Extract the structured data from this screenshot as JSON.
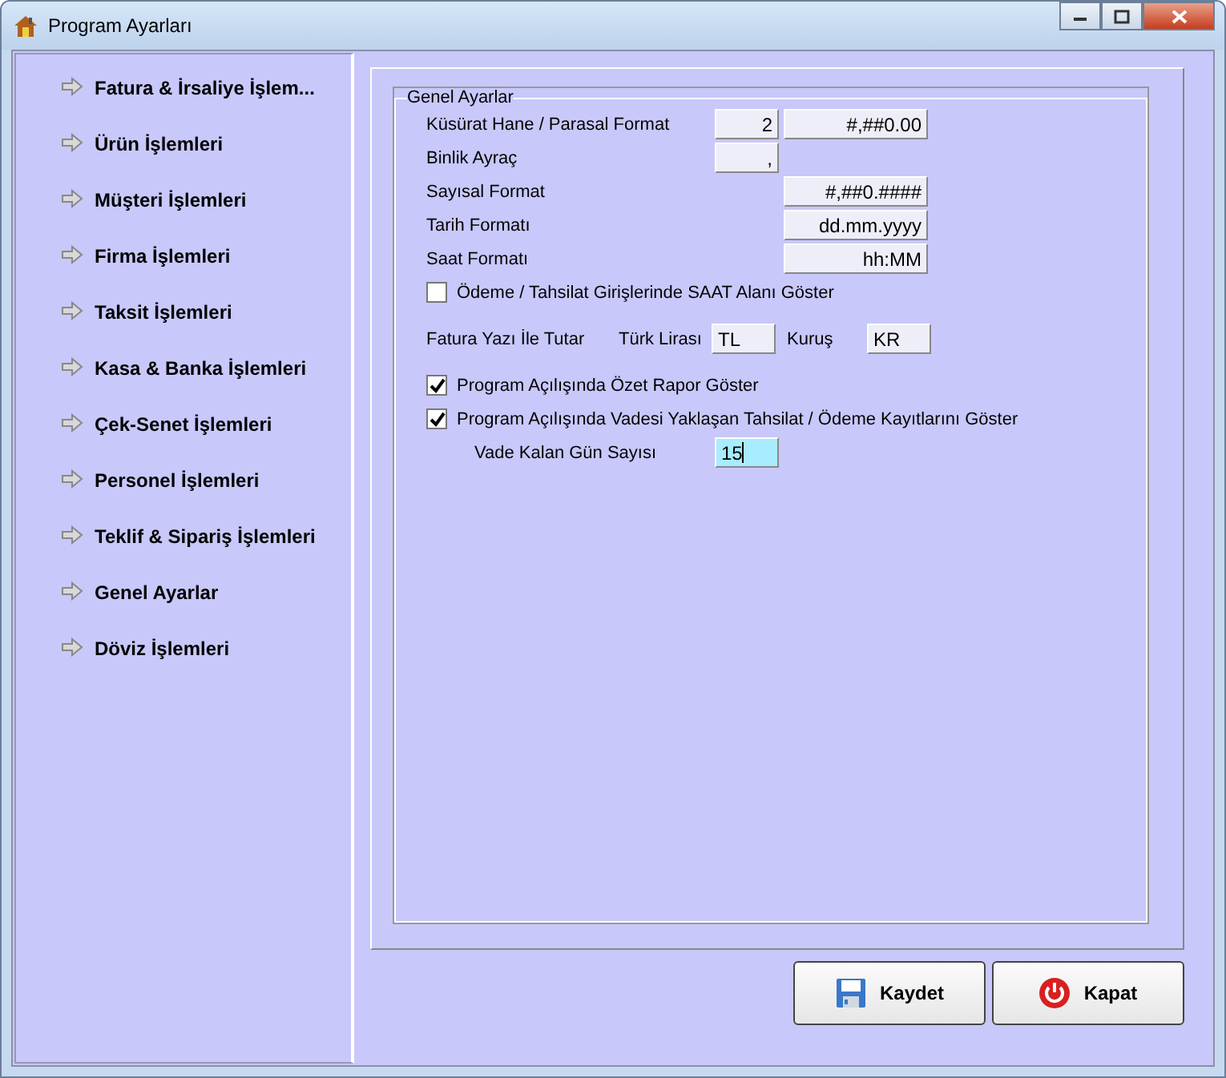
{
  "window": {
    "title": "Program Ayarları"
  },
  "sidebar": {
    "items": [
      {
        "label": "Fatura & İrsaliye İşlem..."
      },
      {
        "label": "Ürün İşlemleri"
      },
      {
        "label": "Müşteri İşlemleri"
      },
      {
        "label": "Firma İşlemleri"
      },
      {
        "label": "Taksit İşlemleri"
      },
      {
        "label": "Kasa & Banka İşlemleri"
      },
      {
        "label": "Çek-Senet İşlemleri"
      },
      {
        "label": "Personel İşlemleri"
      },
      {
        "label": "Teklif & Sipariş İşlemleri"
      },
      {
        "label": "Genel Ayarlar"
      },
      {
        "label": "Döviz İşlemleri"
      }
    ]
  },
  "group": {
    "title": "Genel Ayarlar",
    "rows": [
      {
        "kind": "fields",
        "label": "Küsürat Hane / Parasal Format",
        "small": "2",
        "large": "#,##0.00"
      },
      {
        "kind": "fields",
        "label": "Binlik Ayraç",
        "small": ","
      },
      {
        "kind": "fields",
        "label": "Sayısal Format",
        "large": "#,##0.####"
      },
      {
        "kind": "fields",
        "label": "Tarih Formatı",
        "large": "dd.mm.yyyy"
      },
      {
        "kind": "fields",
        "label": "Saat Formatı",
        "large": "hh:MM"
      },
      {
        "kind": "checkbox",
        "label": "Ödeme / Tahsilat Girişlerinde SAAT Alanı Göster",
        "checked": false
      },
      {
        "kind": "currency",
        "label": "Fatura Yazı İle Tutar",
        "lira_label": "Türk Lirası",
        "lira": "TL",
        "kurus_label": "Kuruş",
        "kurus": "KR"
      },
      {
        "kind": "checkbox",
        "label": "Program Açılışında Özet Rapor Göster",
        "checked": true
      },
      {
        "kind": "checkbox",
        "label": "Program Açılışında Vadesi Yaklaşan Tahsilat / Ödeme Kayıtlarını Göster",
        "checked": true
      },
      {
        "kind": "days",
        "label": "Vade Kalan Gün Sayısı",
        "value": "15",
        "focused": true
      }
    ]
  },
  "buttons": [
    {
      "kind": "save",
      "label": "Kaydet"
    },
    {
      "kind": "close",
      "label": "Kapat"
    }
  ]
}
